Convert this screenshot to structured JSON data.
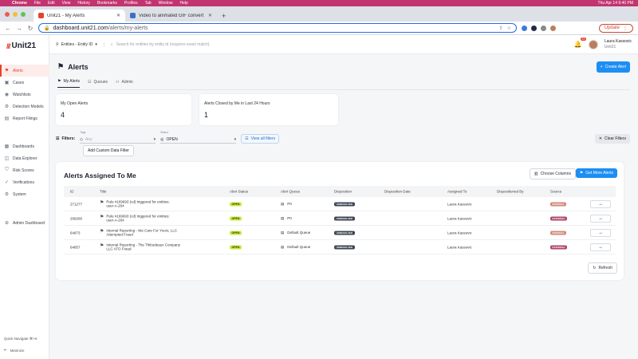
{
  "colors": {
    "menubar": "#c2346f",
    "accent": "#1d8ef3",
    "brand": "#e2432f",
    "open_pill": "#c9ea40",
    "external_pill_1": "#cf8a7a",
    "external_pill_2": "#b0466a"
  },
  "menubar": {
    "items": [
      "Chrome",
      "File",
      "Edit",
      "View",
      "History",
      "Bookmarks",
      "Profiles",
      "Tab",
      "Window",
      "Help"
    ],
    "clock": "Thu Apr 14  9:40 PM"
  },
  "browser": {
    "tabs": [
      {
        "title": "Unit21 - My Alerts",
        "icon": "unit21-favicon"
      },
      {
        "title": "Video to animated GIF convert",
        "icon": "ezgif-favicon"
      }
    ],
    "url_host": "dashboard.unit21.com",
    "url_path": "/alerts/my-alerts",
    "update_label": "Update"
  },
  "sidebar": {
    "logo_text": "Unit21",
    "items_top": [
      {
        "label": "Alerts",
        "icon": "flag-icon",
        "active": true
      },
      {
        "label": "Cases",
        "icon": "briefcase-icon"
      },
      {
        "label": "Watchlists",
        "icon": "eye-icon"
      },
      {
        "label": "Detection Models",
        "icon": "sliders-icon"
      },
      {
        "label": "Report Filings",
        "icon": "document-icon"
      }
    ],
    "items_mid": [
      {
        "label": "Dashboards",
        "icon": "dashboard-icon"
      },
      {
        "label": "Data Explorer",
        "icon": "database-icon"
      },
      {
        "label": "Risk Scores",
        "icon": "shield-icon"
      },
      {
        "label": "Verifications",
        "icon": "check-badge-icon"
      },
      {
        "label": "System",
        "icon": "gear-icon"
      }
    ],
    "items_admin": [
      {
        "label": "Admin Dashboard",
        "icon": "admin-icon"
      }
    ],
    "quick_navigate": "Quick Navigate  ⌘+K",
    "minimize": "Minimize"
  },
  "topbar": {
    "entity_select": "Entities - Entity ID",
    "search_placeholder": "Search for entities by entity id (requires exact match)",
    "notification_count": "23",
    "user_name": "Laura Kassovic",
    "user_org": "Unit21"
  },
  "page": {
    "title": "Alerts",
    "create_button": "Create Alert",
    "tabs": [
      {
        "label": "My Alerts",
        "active": true
      },
      {
        "label": "Queues"
      },
      {
        "label": "Admin"
      }
    ],
    "stats": [
      {
        "label": "My Open Alerts",
        "value": "4"
      },
      {
        "label": "Alerts Closed by Me in Last 24 Hours",
        "value": "1"
      }
    ],
    "filters": {
      "label": "Filters:",
      "tags_label": "Tags",
      "tags_placeholder": "Any",
      "status_label": "Status",
      "status_value": "OPEN",
      "view_all": "View all filters",
      "clear": "Clear Filters",
      "add_custom": "Add Custom Data Filter"
    },
    "table": {
      "title": "Alerts Assigned To Me",
      "choose_columns": "Choose Columns",
      "get_more": "Get More Alerts",
      "refresh": "Refresh",
      "columns": [
        "ID",
        "Title",
        "Alert Status",
        "Alert Queue",
        "Disposition",
        "Disposition Date",
        "Assigned To",
        "Dispositioned By",
        "Source"
      ],
      "rows": [
        {
          "id": "271277",
          "title_1": "Rule #169693 (cd) triggered for entities:",
          "title_2": "user-A-204",
          "status": "OPEN",
          "queue": "P0",
          "disposition": "UNRESOLVED",
          "assigned": "Laura Kassovic",
          "source": "INTERNAL"
        },
        {
          "id": "268266",
          "title_1": "Rule #169693 (cd) triggered for entities:",
          "title_2": "user-A-204",
          "status": "OPEN",
          "queue": "P0",
          "disposition": "UNRESOLVED",
          "assigned": "Laura Kassovic",
          "source": "EXTERNAL"
        },
        {
          "id": "64873",
          "title_1": "Internal Reporting - We Care For Yours, LLC",
          "title_2": "Attempted Fraud",
          "status": "OPEN",
          "queue": "Default Queue",
          "disposition": "UNRESOLVED",
          "assigned": "Laura Kassovic",
          "source": "INTERNAL"
        },
        {
          "id": "64857",
          "title_1": "Internal Reporting - The Thibodeaux Company",
          "title_2": "LLC ATO Fraud",
          "status": "OPEN",
          "queue": "Default Queue",
          "disposition": "UNRESOLVED",
          "assigned": "Laura Kassovic",
          "source": "EXTERNAL"
        }
      ]
    }
  }
}
